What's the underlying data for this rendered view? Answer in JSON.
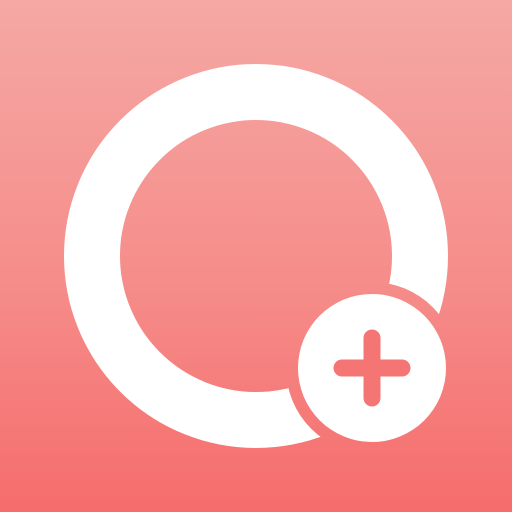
{
  "icon": {
    "name": "circle-with-add-badge",
    "shapes": [
      "ring-icon",
      "plus-badge-icon"
    ]
  },
  "colors": {
    "background_top": "#f5a8a4",
    "background_bottom": "#f56d6c",
    "ring": "#ffffff",
    "badge": "#ffffff",
    "plus": "#f57574"
  }
}
